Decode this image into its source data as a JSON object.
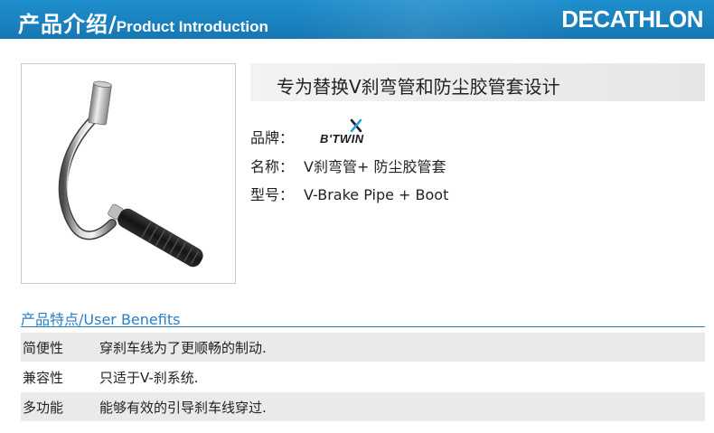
{
  "header": {
    "title_zh": "产品介绍",
    "separator": "/",
    "title_en": "Product Introduction",
    "logo_text": "DECATHLON",
    "bg_color": "#1a82c0"
  },
  "product": {
    "tagline": "专为替换V刹弯管和防尘胶管套设计",
    "image_icon": "v-brake-pipe-icon",
    "specs": [
      {
        "key": "品牌",
        "colon": "：",
        "value": ""
      },
      {
        "key": "名称",
        "colon": "：",
        "value": "V刹弯管+ 防尘胶管套"
      },
      {
        "key": "型号",
        "colon": "：",
        "value": "V-Brake Pipe + Boot"
      }
    ],
    "brand_logo_text": "B'TWIN",
    "brand_logo_colors": {
      "x_blue": "#27a3dc",
      "x_dark": "#222222"
    }
  },
  "benefits": {
    "title": "产品特点/User Benefits",
    "accent_color": "#2a7ec6",
    "rows": [
      {
        "label": "简便性",
        "text": "穿刹车线为了更顺畅的制动."
      },
      {
        "label": "兼容性",
        "text": "只适于V-刹系统."
      },
      {
        "label": "多功能",
        "text": "能够有效的引导刹车线穿过."
      }
    ]
  }
}
